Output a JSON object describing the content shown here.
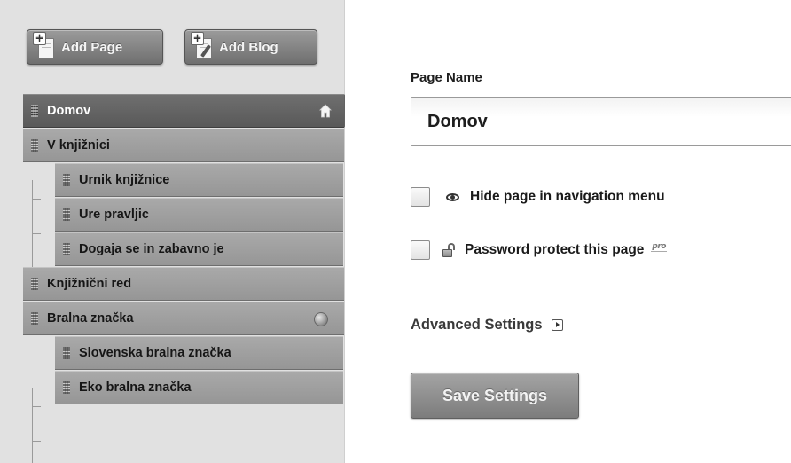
{
  "toolbar": {
    "add_page_label": "Add Page",
    "add_blog_label": "Add Blog"
  },
  "sidebar": {
    "items": [
      {
        "label": "Domov",
        "level": 0,
        "active": true,
        "icon": "home-icon"
      },
      {
        "label": "V knjižnici",
        "level": 0,
        "active": false
      },
      {
        "label": "Urnik knjižnice",
        "level": 1,
        "active": false
      },
      {
        "label": "Ure pravljic",
        "level": 1,
        "active": false
      },
      {
        "label": "Dogaja se in zabavno je",
        "level": 1,
        "active": false
      },
      {
        "label": "Knjižnični red",
        "level": 0,
        "active": false
      },
      {
        "label": "Bralna značka",
        "level": 0,
        "active": false,
        "icon": "globe-icon"
      },
      {
        "label": "Slovenska bralna značka",
        "level": 1,
        "active": false
      },
      {
        "label": "Eko bralna značka",
        "level": 1,
        "active": false
      }
    ]
  },
  "form": {
    "page_name_label": "Page Name",
    "page_name_value": "Domov",
    "hide_page_label": "Hide page in navigation menu",
    "hide_page_checked": false,
    "password_label": "Password protect this page",
    "password_checked": false,
    "pro_badge": "pro",
    "advanced_label": "Advanced Settings",
    "save_label": "Save Settings"
  }
}
